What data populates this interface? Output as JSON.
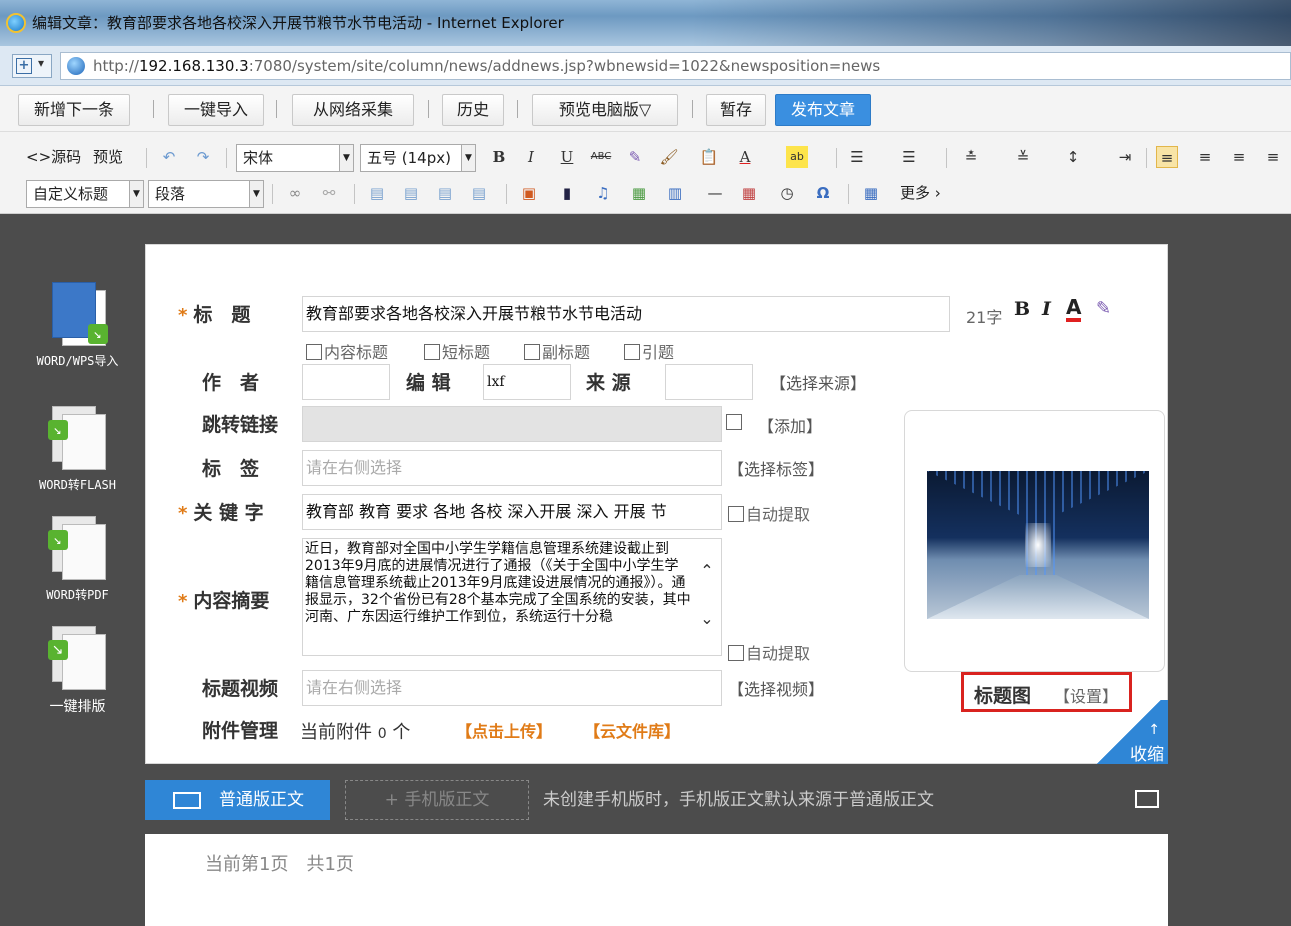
{
  "window": {
    "title": "编辑文章：教育部要求各地各校深入开展节粮节水节电活动 - Internet Explorer"
  },
  "address": {
    "url_prefix": "http://",
    "url_host": "192.168.130.3",
    "url_rest": ":7080/system/site/column/news/addnews.jsp?wbnewsid=1022&newsposition=news",
    "fav_icon": "add-favorite-icon"
  },
  "toolbar": {
    "new_next": "新增下一条",
    "import": "一键导入",
    "collect": "从网络采集",
    "history": "历史",
    "preview": "预览电脑版▽",
    "save": "暂存",
    "publish": "发布文章",
    "publish_color": "#3a8fe0"
  },
  "editor": {
    "source": "<>源码",
    "preview": "预览",
    "font": "宋体",
    "size": "五号 (14px)",
    "custom_title": "自定义标题",
    "paragraph": "段落",
    "more": "更多 ›"
  },
  "side_tools": [
    {
      "label": "WORD/WPS导入",
      "icon": "word-import-icon"
    },
    {
      "label": "WORD转FLASH",
      "icon": "word-to-flash-icon"
    },
    {
      "label": "WORD转PDF",
      "icon": "word-to-pdf-icon"
    },
    {
      "label": "一键排版",
      "icon": "one-click-layout-icon"
    }
  ],
  "form": {
    "title_label": "标　题",
    "title_value": "教育部要求各地各校深入开展节粮节水节电活动",
    "title_count": "21字",
    "title_opts": [
      "内容标题",
      "短标题",
      "副标题",
      "引题"
    ],
    "author_label": "作　者",
    "author_value": "",
    "editor_label": "编 辑",
    "editor_value": "lxf",
    "source_label": "来 源",
    "source_value": "",
    "source_select": "【选择来源】",
    "redirect_label": "跳转链接",
    "redirect_add": "【添加】",
    "tag_label": "标　签",
    "tag_placeholder": "请在右侧选择",
    "tag_select": "【选择标签】",
    "keyword_label": "关 键 字",
    "keyword_value": "教育部 教育 要求 各地 各校 深入开展 深入 开展 节",
    "auto_extract": "自动提取",
    "summary_label": "内容摘要",
    "summary_value": "近日，教育部对全国中小学生学籍信息管理系统建设截止到2013年9月底的进展情况进行了通报（《关于全国中小学生学籍信息管理系统截止2013年9月底建设进展情况的通报》）。通报显示，32个省份已有28个基本完成了全国系统的安装，其中河南、广东因运行维护工作到位，系统运行十分稳",
    "summary_auto": "自动提取",
    "video_label": "标题视频",
    "video_placeholder": "请在右侧选择",
    "video_select": "【选择视频】",
    "attach_label": "附件管理",
    "attach_current": "当前附件",
    "attach_count": "0",
    "attach_unit": "个",
    "upload": "【点击上传】",
    "cloud": "【云文件库】",
    "title_pic": "标题图",
    "title_pic_set": "【设置】",
    "collapse": "收缩"
  },
  "body_tabs": {
    "normal": "普通版正文",
    "mobile": "+ 手机版正文",
    "note": "未创建手机版时，手机版正文默认来源于普通版正文",
    "page_info": "当前第1页　共1页"
  }
}
